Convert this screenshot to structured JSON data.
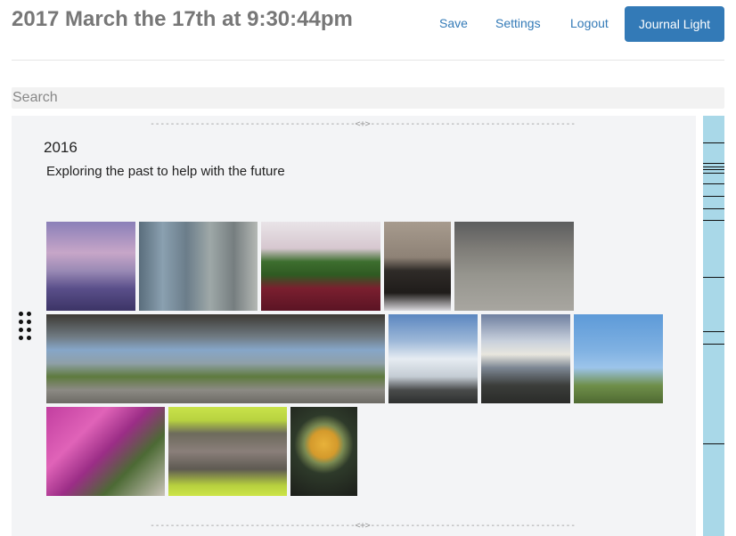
{
  "header": {
    "title": "2017 March the 17th at 9:30:44pm",
    "save_label": "Save",
    "settings_label": "Settings",
    "logout_label": "Logout",
    "journal_light_label": "Journal Light"
  },
  "search": {
    "placeholder": "Search"
  },
  "entry": {
    "divider_text": "-----------------------------------------<+>-----------------------------------------",
    "year": "2016",
    "subtitle": "Exploring the past to help with the future"
  },
  "colors": {
    "accent": "#337ab7",
    "sidebar": "#a9d8e8",
    "panel": "#f3f4f6"
  }
}
